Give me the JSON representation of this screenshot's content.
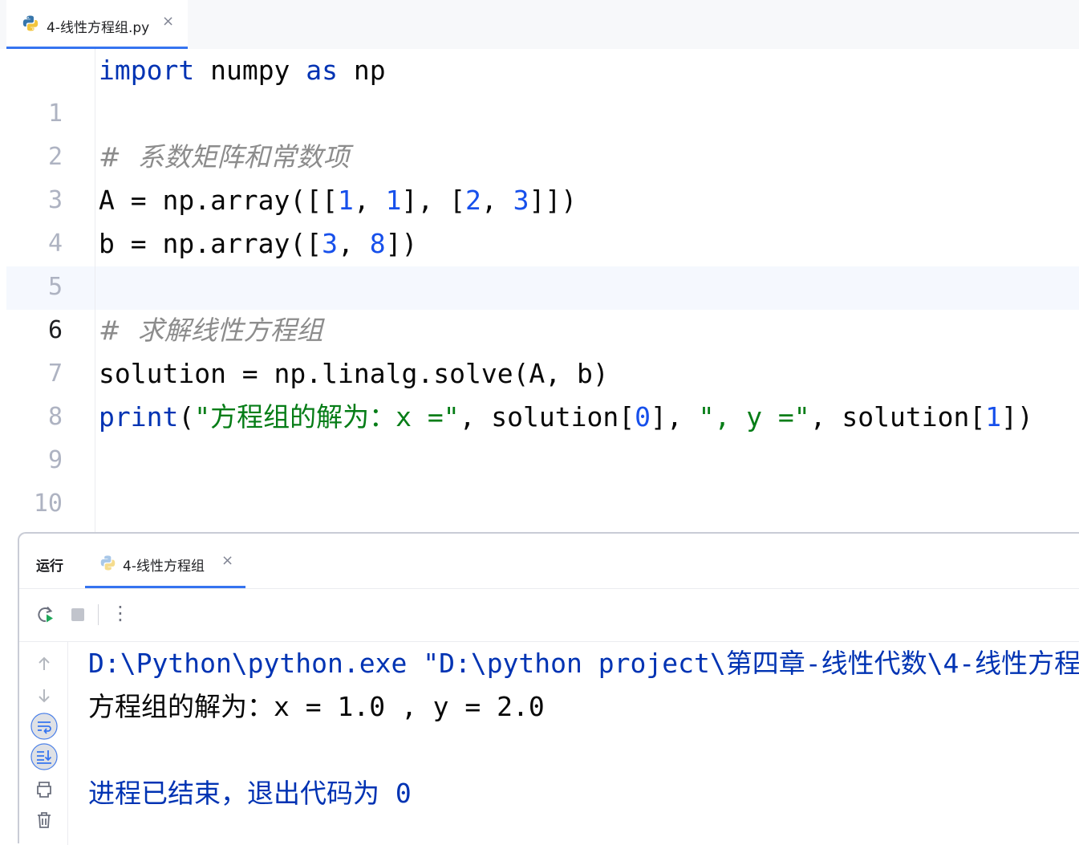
{
  "editor_tab": {
    "label": "4-线性方程组.py",
    "close_glyph": "×",
    "icon": "python-file-icon"
  },
  "editor": {
    "current_line": 6,
    "lines": [
      {
        "num": "1",
        "code": "import numpy as np"
      },
      {
        "num": "2",
        "code": ""
      },
      {
        "num": "3",
        "code": "#  系数矩阵和常数项"
      },
      {
        "num": "4",
        "code": "A = np.array([[1, 1], [2, 3]])"
      },
      {
        "num": "5",
        "code": "b = np.array([3, 8])"
      },
      {
        "num": "6",
        "code": ""
      },
      {
        "num": "7",
        "code": "#  求解线性方程组"
      },
      {
        "num": "8",
        "code": "solution = np.linalg.solve(A, b)"
      },
      {
        "num": "9",
        "code": "print(\"方程组的解为：x =\", solution[0], \", y =\", solution[1])"
      },
      {
        "num": "10",
        "code": ""
      }
    ]
  },
  "run_panel": {
    "title": "运行",
    "tab_label": "4-线性方程组",
    "close_glyph": "×",
    "toolbar": {
      "rerun_icon": "rerun-icon",
      "stop_icon": "stop-icon",
      "more_icon": "more-vertical-icon",
      "more_glyph": "⋮"
    },
    "side_icons": [
      "scroll-up-icon",
      "scroll-down-icon",
      "soft-wrap-icon",
      "scroll-to-end-icon",
      "print-icon",
      "trash-icon"
    ],
    "console": {
      "command": "D:\\Python\\python.exe \"D:\\python project\\第四章-线性代数\\4-线性方程",
      "output": "方程组的解为：x = 1.0 , y = 2.0",
      "exit_message": "进程已结束，退出代码为 0"
    }
  },
  "colors": {
    "keyword": "#0033b3",
    "number": "#1750eb",
    "string": "#067d17",
    "comment": "#8c8c8c",
    "accent": "#3574f0",
    "caret_row": "#f5f8fe"
  }
}
